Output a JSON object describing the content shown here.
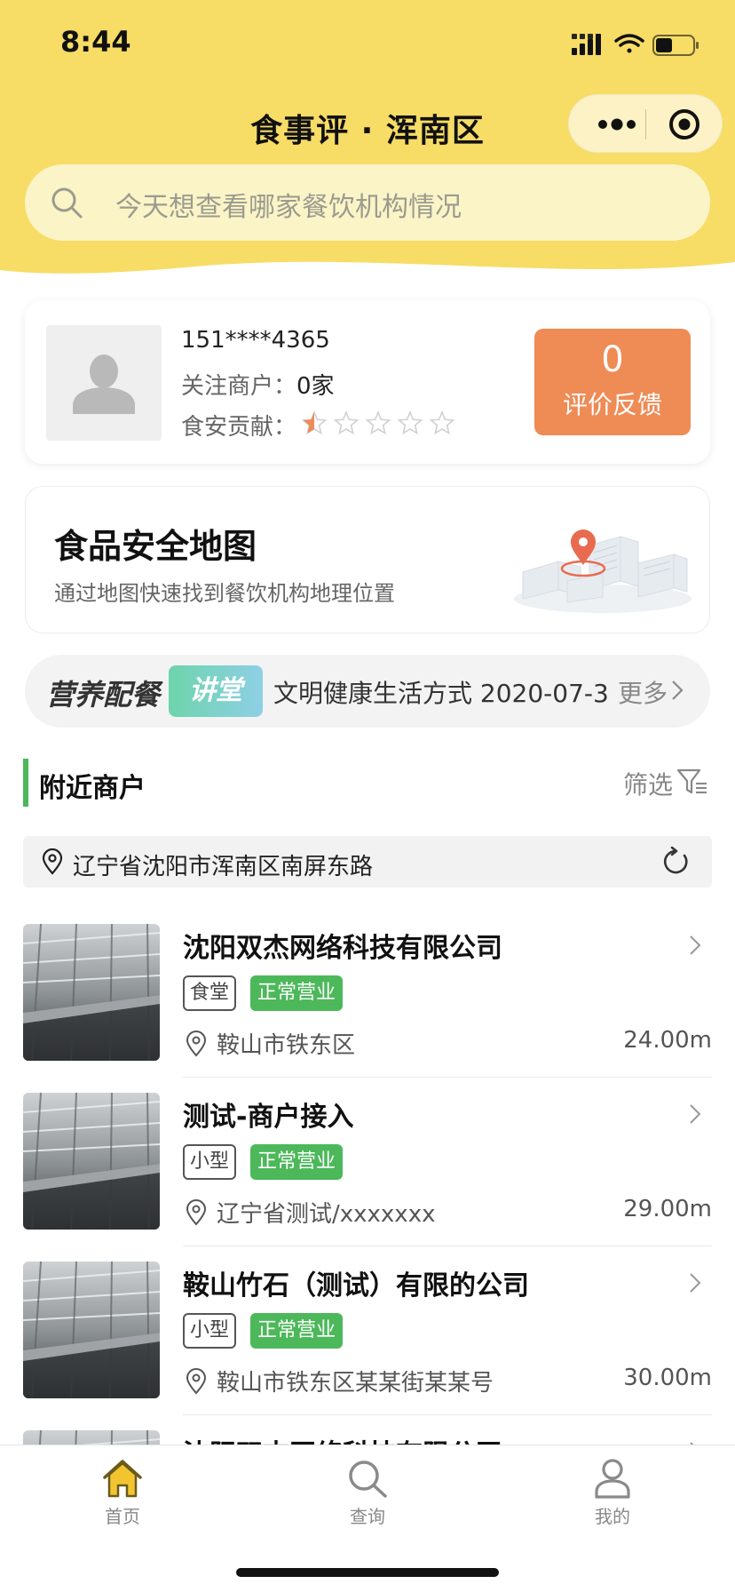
{
  "status_bar": {
    "time": "8:44"
  },
  "header": {
    "title": "食事评 · 浑南区",
    "search_placeholder": "今天想查看哪家餐饮机构情况",
    "colors": {
      "header_bg": "#f7dc66",
      "search_bg": "#fbf4c7"
    }
  },
  "user_card": {
    "phone": "151****4365",
    "follow_label": "关注商户：",
    "follow_value": "0家",
    "contribution_label": "食安贡献：",
    "contribution_rating": 0.5,
    "contribution_max": 5,
    "feedback_count": "0",
    "feedback_label": "评价反馈",
    "feedback_color": "#ef8b55"
  },
  "map_card": {
    "title": "食品安全地图",
    "subtitle": "通过地图快速找到餐饮机构地理位置"
  },
  "nutrition_banner": {
    "brand": "营养配餐",
    "tag": "讲堂",
    "headline": "文明健康生活方式 2020-07-3",
    "more": "更多"
  },
  "nearby": {
    "title": "附近商户",
    "filter_label": "筛选",
    "location": "辽宁省沈阳市浑南区南屏东路",
    "accent_color": "#4cb85a",
    "merchants": [
      {
        "name": "沈阳双杰网络科技有限公司",
        "type": "食堂",
        "status": "正常营业",
        "address": "鞍山市铁东区",
        "distance": "24.00m"
      },
      {
        "name": "测试-商户接入",
        "type": "小型",
        "status": "正常营业",
        "address": "辽宁省测试/xxxxxxx",
        "distance": "29.00m"
      },
      {
        "name": "鞍山竹石（测试）有限的公司",
        "type": "小型",
        "status": "正常营业",
        "address": "鞍山市铁东区某某街某某号",
        "distance": "30.00m"
      },
      {
        "name": "沈阳双杰网络科技有限公司",
        "type": "",
        "status": "",
        "address": "",
        "distance": ""
      }
    ]
  },
  "tabbar": {
    "tabs": [
      {
        "label": "首页",
        "icon": "home-icon",
        "active": true
      },
      {
        "label": "查询",
        "icon": "search-icon",
        "active": false
      },
      {
        "label": "我的",
        "icon": "user-icon",
        "active": false
      }
    ],
    "active_color": "#f2c530"
  }
}
